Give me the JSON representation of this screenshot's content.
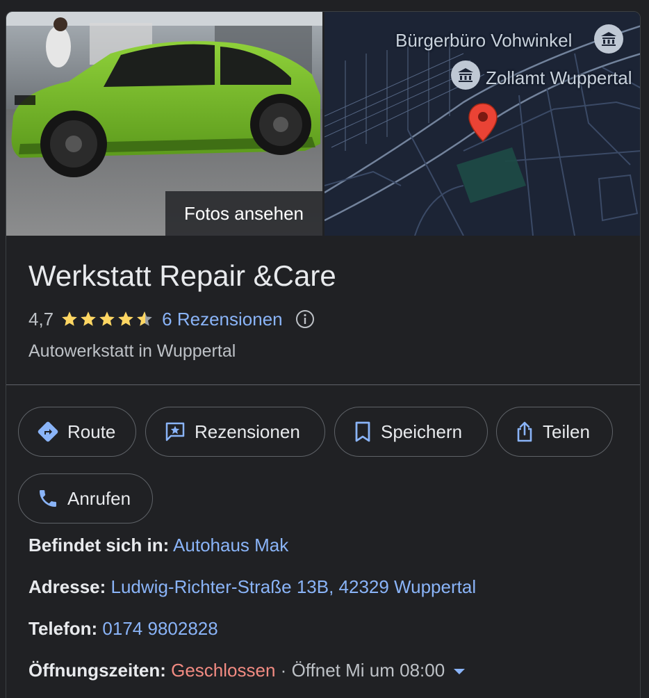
{
  "photos_button": "Fotos ansehen",
  "map": {
    "label_1": "Bürgerbüro Vohwinkel",
    "label_2": "Zollamt Wuppertal"
  },
  "business": {
    "name": "Werkstatt Repair &Care",
    "rating": "4,7",
    "rating_value": 4.7,
    "reviews_link": "6 Rezensionen",
    "category": "Autowerkstatt in Wuppertal"
  },
  "actions": {
    "route": "Route",
    "reviews": "Rezensionen",
    "save": "Speichern",
    "share": "Teilen",
    "call": "Anrufen"
  },
  "details": {
    "located_in_label": "Befindet sich in:",
    "located_in_value": "Autohaus Mak",
    "address_label": "Adresse:",
    "address_value": "Ludwig-Richter-Straße 13B, 42329 Wuppertal",
    "phone_label": "Telefon:",
    "phone_value": "0174 9802828",
    "hours_label": "Öffnungszeiten:",
    "hours_status": "Geschlossen",
    "hours_sep": "·",
    "hours_next": "Öffnet Mi um 08:00"
  },
  "colors": {
    "background": "#202124",
    "link": "#8ab4f8",
    "star": "#fdd663",
    "closed": "#f28b82",
    "map_bg": "#1c2435"
  },
  "icons": [
    "route-icon",
    "review-icon",
    "bookmark-icon",
    "share-icon",
    "phone-icon",
    "info-icon",
    "museum-icon",
    "map-pin-icon"
  ]
}
